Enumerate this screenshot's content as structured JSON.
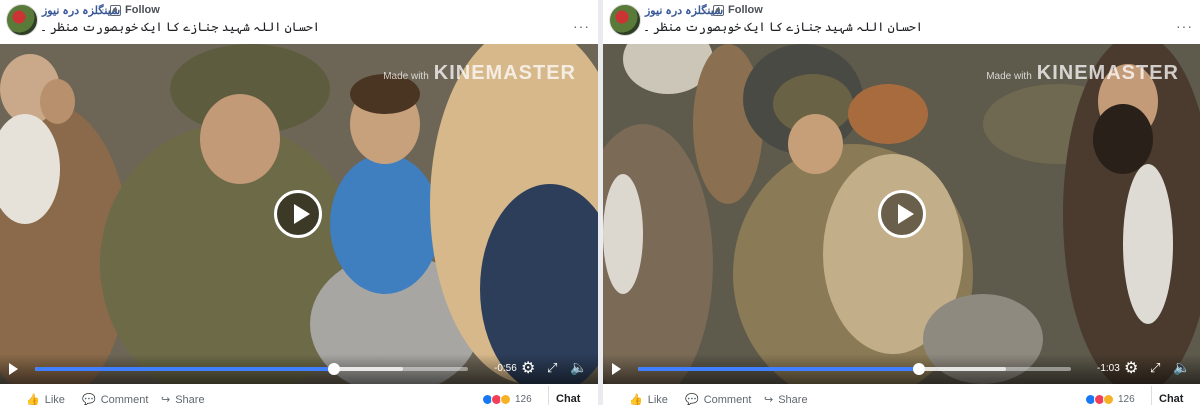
{
  "posts": [
    {
      "page_name": "شینگلزہ درہ نیوز",
      "follow_label": "Follow",
      "more_label": "···",
      "caption": "احسان اللہ شہید جنازے کا ایک خوبصورت منظر ۔",
      "watermark": {
        "made_with": "Made with",
        "brand": "KINEMASTER"
      },
      "video": {
        "time_remaining": "-0:56",
        "progress": 0.69,
        "buffered": 0.85
      },
      "actions": {
        "like": "Like",
        "comment": "Comment",
        "share": "Share"
      },
      "reactions": {
        "count": "126"
      },
      "chat_label": "Chat (Off"
    },
    {
      "page_name": "شینگلزہ درہ نیوز",
      "follow_label": "Follow",
      "more_label": "···",
      "caption": "احسان اللہ شہید جنازے کا ایک خوبصورت منظر ۔",
      "watermark": {
        "made_with": "Made with",
        "brand": "KINEMASTER"
      },
      "video": {
        "time_remaining": "-1:03",
        "progress": 0.65,
        "buffered": 0.85
      },
      "actions": {
        "like": "Like",
        "comment": "Comment",
        "share": "Share"
      },
      "reactions": {
        "count": "126"
      },
      "chat_label": "Chat (Off"
    }
  ],
  "icons": {
    "follow": "follow-icon",
    "play": "play-icon",
    "settings": "gear-icon",
    "fullscreen": "expand-icon",
    "volume": "volume-icon",
    "like": "thumbs-up-icon",
    "comment": "comment-icon",
    "share": "share-icon"
  },
  "colors": {
    "link": "#385898",
    "progress": "#4080ff",
    "background": "#e9ebee",
    "reaction_like": "#1877f2",
    "reaction_love": "#f33e58",
    "reaction_haha": "#f7b125"
  }
}
